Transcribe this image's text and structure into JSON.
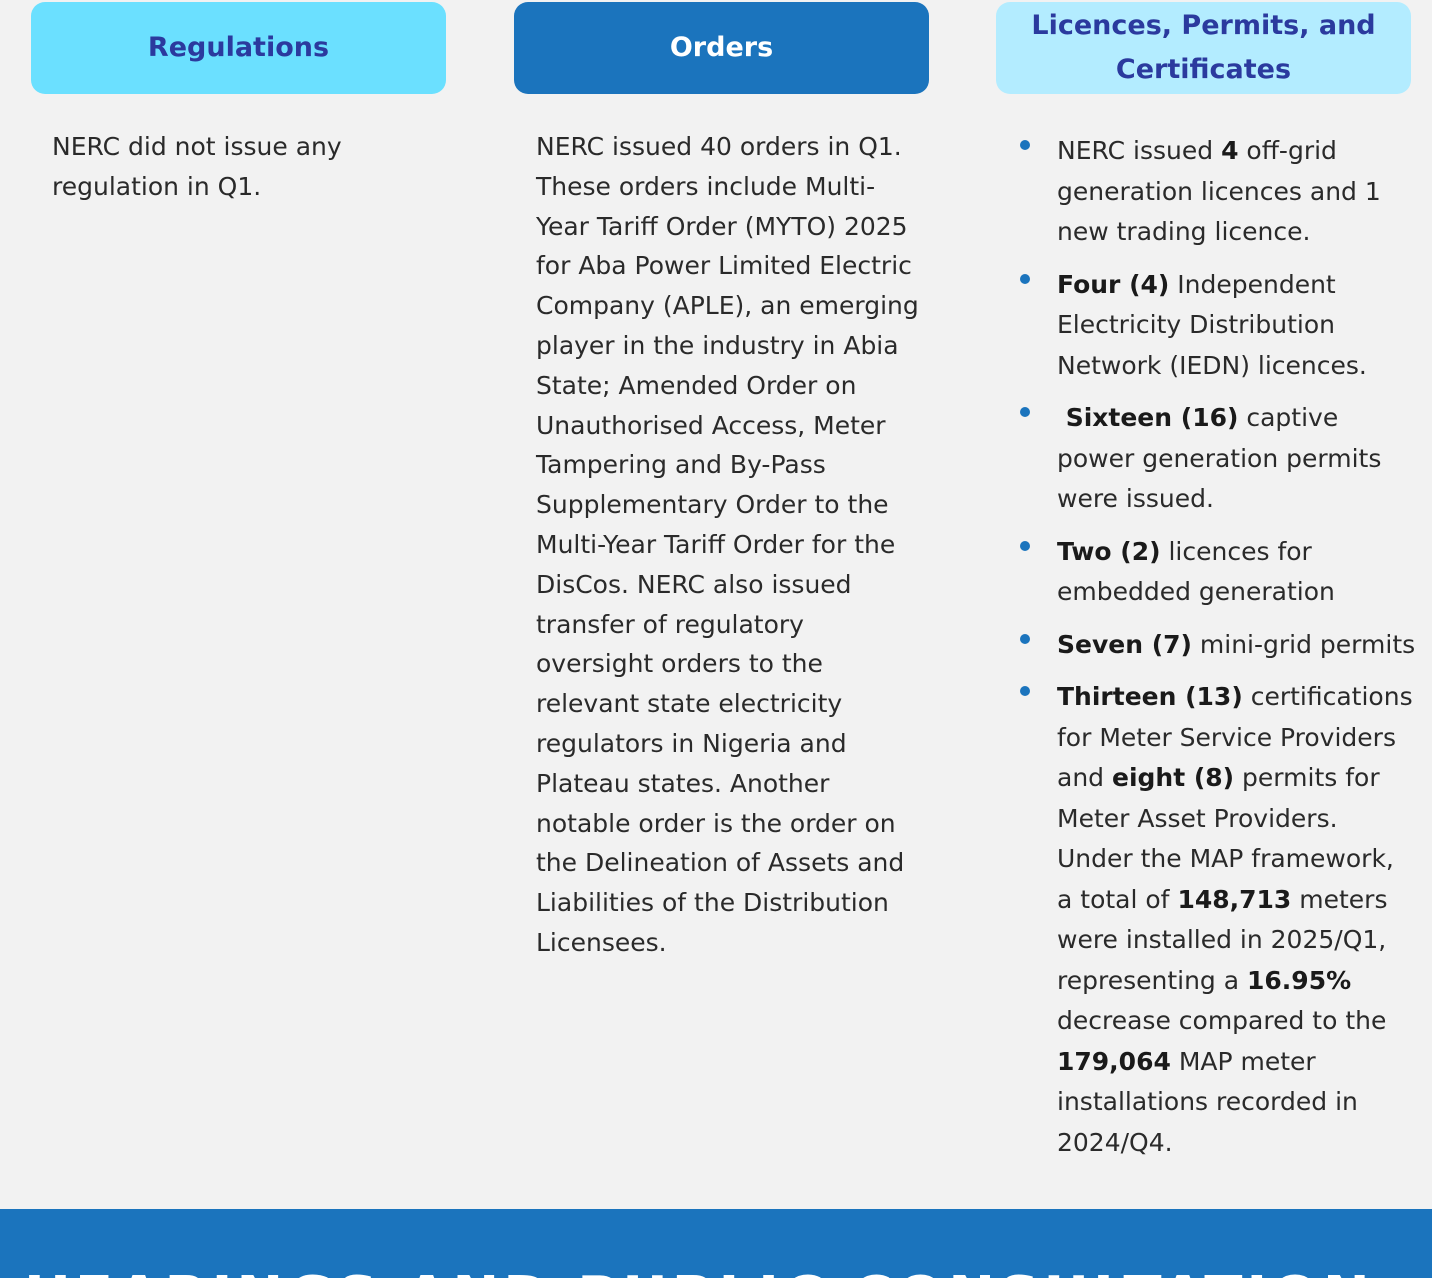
{
  "columns": {
    "regulations": {
      "title": "Regulations",
      "text": "NERC did not issue any regulation in Q1."
    },
    "orders": {
      "title": "Orders",
      "text": "NERC issued 40 orders in Q1. These orders include Multi-Year Tariff Order (MYTO) 2025 for Aba Power Limited Electric Company (APLE), an emerging player in the industry in Abia State; Amended Order on Unauthorised Access, Meter Tampering and By-Pass Supplementary Order to the Multi-Year Tariff Order for the DisCos. NERC also issued transfer of regulatory oversight orders to the relevant state electricity regulators in Nigeria and Plateau states. Another notable order is the order on the Delineation of Assets and Liabilities of the Distribution Licensees."
    },
    "licences": {
      "title": "Licences, Permits, and Certificates",
      "items": [
        {
          "a": "NERC issued ",
          "b1": "4",
          "c": " off-grid generation licences and 1 new trading licence."
        },
        {
          "b1": "Four (4)",
          "c": " Independent Electricity Distribution Network (IEDN) licences."
        },
        {
          "b1": " Sixteen (16)",
          "c": " captive power generation permits were issued."
        },
        {
          "b1": "Two (2)",
          "c": " licences for embedded generation"
        },
        {
          "b1": "Seven (7)",
          "c": " mini-grid permits"
        },
        {
          "b1": "Thirteen (13)",
          "c": " certifications for Meter Service Providers and ",
          "b2": "eight (8)",
          "d": " permits for Meter Asset Providers. Under the MAP framework, a total of ",
          "b3": "148,713",
          "e": " meters were installed in 2025/Q1, representing a ",
          "b4": "16.95%",
          "f": " decrease compared to the ",
          "b5": "179,064",
          "g": " MAP meter installations recorded in 2024/Q4."
        }
      ]
    }
  },
  "footer": {
    "heading": "HEARINGS AND PUBLIC CONSULTATION"
  },
  "colors": {
    "background": "#f2f2f2",
    "regulations_header": "#6be0ff",
    "orders_header": "#1b74bd",
    "licences_header": "#b3ecff",
    "header_text_dark": "#2b3a9e",
    "bullet": "#1b74bd",
    "footer_band": "#1b74bd"
  }
}
